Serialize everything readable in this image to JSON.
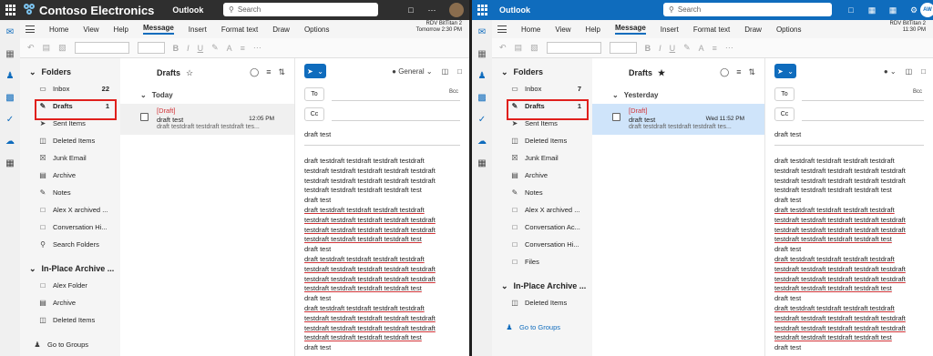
{
  "left": {
    "brand": "Contoso Electronics",
    "app": "Outlook",
    "search_placeholder": "Search",
    "avatar_initials": "",
    "menu": [
      "Home",
      "View",
      "Help",
      "Message",
      "Insert",
      "Format text",
      "Draw",
      "Options"
    ],
    "menu_active": "Message",
    "rdv_line1": "RDV BitTitan 2",
    "rdv_line2": "Tomorrow 2:30 PM",
    "folders_title": "Folders",
    "folders": [
      {
        "label": "Inbox",
        "count": "22",
        "icon": "inbox-icon"
      },
      {
        "label": "Drafts",
        "count": "1",
        "icon": "pencil-icon"
      },
      {
        "label": "Sent Items",
        "count": "",
        "icon": "send-icon"
      },
      {
        "label": "Deleted Items",
        "count": "",
        "icon": "trash-icon"
      },
      {
        "label": "Junk Email",
        "count": "",
        "icon": "junk-icon"
      },
      {
        "label": "Archive",
        "count": "",
        "icon": "archive-icon"
      },
      {
        "label": "Notes",
        "count": "",
        "icon": "note-icon"
      },
      {
        "label": "Alex X archived ...",
        "count": "",
        "icon": "folder-icon"
      },
      {
        "label": "Conversation Hi...",
        "count": "",
        "icon": "folder-icon"
      },
      {
        "label": "Search Folders",
        "count": "",
        "icon": "search-folder-icon"
      }
    ],
    "archive_title": "In-Place Archive ...",
    "archive_folders": [
      {
        "label": "Alex Folder",
        "icon": "folder-icon"
      },
      {
        "label": "Archive",
        "icon": "archive-icon"
      },
      {
        "label": "Deleted Items",
        "icon": "trash-icon"
      }
    ],
    "go_to_groups": "Go to Groups",
    "list_title": "Drafts",
    "group_label": "Today",
    "message": {
      "tag": "[Draft]",
      "subject": "draft test",
      "time": "12:05 PM",
      "preview": "draft testdraft testdraft testdraft tes..."
    },
    "sensitivity": "General",
    "to_label": "To",
    "cc_label": "Cc",
    "bcc_label": "Bcc",
    "subject": "draft test"
  },
  "right": {
    "app": "Outlook",
    "search_placeholder": "Search",
    "avatar_initials": "AW",
    "menu": [
      "Home",
      "View",
      "Help",
      "Message",
      "Insert",
      "Format text",
      "Draw",
      "Options"
    ],
    "menu_active": "Message",
    "rdv_line1": "RDV BitTitan 2",
    "rdv_line2": "11:30 PM",
    "folders_title": "Folders",
    "folders": [
      {
        "label": "Inbox",
        "count": "7",
        "icon": "inbox-icon"
      },
      {
        "label": "Drafts",
        "count": "1",
        "icon": "pencil-icon"
      },
      {
        "label": "Sent Items",
        "count": "",
        "icon": "send-icon"
      },
      {
        "label": "Deleted Items",
        "count": "",
        "icon": "trash-icon"
      },
      {
        "label": "Junk Email",
        "count": "",
        "icon": "junk-icon"
      },
      {
        "label": "Archive",
        "count": "",
        "icon": "archive-icon"
      },
      {
        "label": "Notes",
        "count": "",
        "icon": "note-icon"
      },
      {
        "label": "Alex X archived ...",
        "count": "",
        "icon": "folder-icon"
      },
      {
        "label": "Conversation Ac...",
        "count": "",
        "icon": "folder-icon"
      },
      {
        "label": "Conversation Hi...",
        "count": "",
        "icon": "folder-icon"
      },
      {
        "label": "Files",
        "count": "",
        "icon": "folder-icon"
      }
    ],
    "archive_title": "In-Place Archive ...",
    "archive_folders": [
      {
        "label": "Deleted Items",
        "icon": "trash-icon"
      }
    ],
    "go_to_groups": "Go to Groups",
    "list_title": "Drafts",
    "group_label": "Yesterday",
    "message": {
      "tag": "[Draft]",
      "subject": "draft test",
      "time": "Wed 11:52 PM",
      "preview": "draft testdraft testdraft testdraft tes..."
    },
    "to_label": "To",
    "cc_label": "Cc",
    "bcc_label": "Bcc",
    "subject": "draft test"
  },
  "body_lines": [
    {
      "text": "draft testdraft testdraft testdraft testdraft",
      "underline": false
    },
    {
      "text": "testdraft testdraft testdraft testdraft testdraft",
      "underline": false
    },
    {
      "text": "testdraft testdraft testdraft testdraft testdraft",
      "underline": false
    },
    {
      "text": "testdraft testdraft testdraft testdraft test",
      "underline": false
    },
    {
      "text": "draft test",
      "underline": false
    },
    {
      "text": "draft testdraft testdraft testdraft testdraft",
      "underline": true
    },
    {
      "text": "testdraft testdraft testdraft testdraft testdraft",
      "underline": true
    },
    {
      "text": "testdraft testdraft testdraft testdraft testdraft",
      "underline": true
    },
    {
      "text": "testdraft testdraft testdraft testdraft test",
      "underline": true
    },
    {
      "text": "draft test",
      "underline": false
    },
    {
      "text": "draft testdraft testdraft testdraft testdraft",
      "underline": true
    },
    {
      "text": "testdraft testdraft testdraft testdraft testdraft",
      "underline": true
    },
    {
      "text": "testdraft testdraft testdraft testdraft testdraft",
      "underline": true
    },
    {
      "text": "testdraft testdraft testdraft testdraft test",
      "underline": true
    },
    {
      "text": "draft test",
      "underline": false
    },
    {
      "text": "draft testdraft testdraft testdraft testdraft",
      "underline": true
    },
    {
      "text": "testdraft testdraft testdraft testdraft testdraft",
      "underline": true
    },
    {
      "text": "testdraft testdraft testdraft testdraft testdraft",
      "underline": true
    },
    {
      "text": "testdraft testdraft testdraft testdraft test",
      "underline": true
    },
    {
      "text": "draft test",
      "underline": false
    }
  ],
  "colors": {
    "brand_bar_dark": "#2f2f2f",
    "brand_bar_blue": "#0f6cbd",
    "highlight": "#e0201c",
    "selected_row": "#cfe4fa"
  }
}
